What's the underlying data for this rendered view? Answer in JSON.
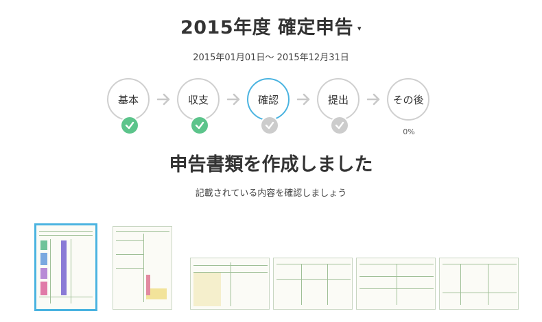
{
  "header": {
    "title": "2015年度 確定申告",
    "caret": "▾",
    "period": "2015年01月01日〜 2015年12月31日"
  },
  "steps": [
    {
      "label": "基本",
      "status": "done"
    },
    {
      "label": "収支",
      "status": "done"
    },
    {
      "label": "確認",
      "status": "active"
    },
    {
      "label": "提出",
      "status": "pending"
    },
    {
      "label": "その後",
      "status": "none",
      "progress": "0%"
    }
  ],
  "main": {
    "headline": "申告書類を作成しました",
    "subtext": "記載されている内容を確認しましょう"
  },
  "documents": {
    "count": 6,
    "selected_index": 0
  },
  "colors": {
    "accent": "#4ab3e0",
    "done": "#5cc48b",
    "pending": "#cccccc",
    "ring": "#cfcfcf"
  }
}
